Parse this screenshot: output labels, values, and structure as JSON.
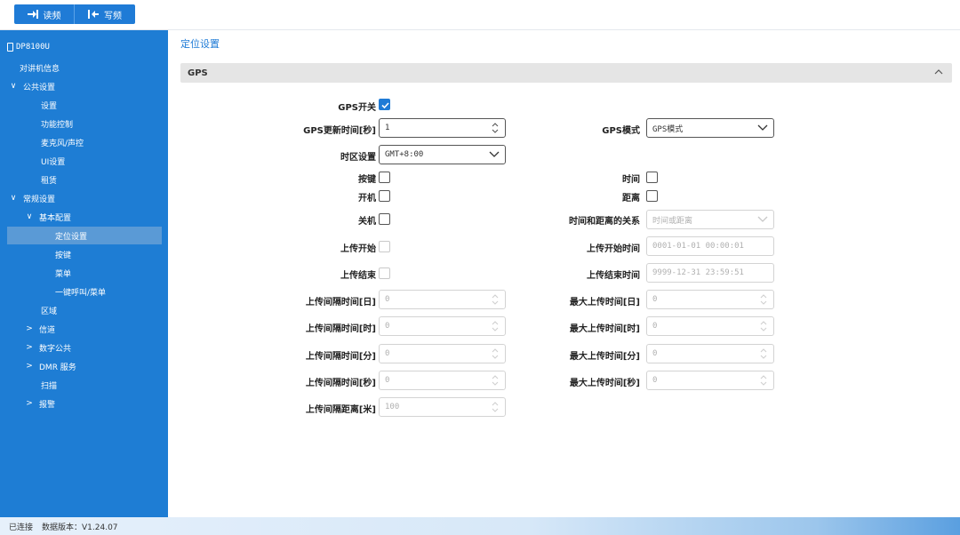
{
  "toolbar": {
    "read_label": "读频",
    "write_label": "写频"
  },
  "sidebar": {
    "device": "DP8100U",
    "items": [
      {
        "label": "对讲机信息",
        "chevron": ""
      },
      {
        "label": "公共设置",
        "chevron": "∨"
      },
      {
        "label": "设置",
        "chevron": ""
      },
      {
        "label": "功能控制",
        "chevron": ""
      },
      {
        "label": "麦克风/声控",
        "chevron": ""
      },
      {
        "label": "UI设置",
        "chevron": ""
      },
      {
        "label": "租赁",
        "chevron": ""
      },
      {
        "label": "常规设置",
        "chevron": "∨"
      },
      {
        "label": "基本配置",
        "chevron": "∨"
      },
      {
        "label": "定位设置",
        "chevron": "",
        "selected": true
      },
      {
        "label": "按键",
        "chevron": ""
      },
      {
        "label": "菜单",
        "chevron": ""
      },
      {
        "label": "一键呼叫/菜单",
        "chevron": ""
      },
      {
        "label": "区域",
        "chevron": ""
      },
      {
        "label": "信道",
        "chevron": ">"
      },
      {
        "label": "数字公共",
        "chevron": ">"
      },
      {
        "label": "DMR 服务",
        "chevron": ">"
      },
      {
        "label": "扫描",
        "chevron": ""
      },
      {
        "label": "报警",
        "chevron": ">"
      }
    ]
  },
  "main": {
    "page_title": "定位设置",
    "section_title": "GPS",
    "gps_switch": {
      "label": "GPS开关",
      "checked": true
    },
    "gps_update": {
      "label": "GPS更新时间[秒]",
      "value": "1"
    },
    "gps_mode": {
      "label": "GPS模式",
      "value": "GPS模式"
    },
    "timezone": {
      "label": "时区设置",
      "value": "GMT+8:00"
    },
    "key": {
      "label": "按键"
    },
    "time": {
      "label": "时间"
    },
    "power_on": {
      "label": "开机"
    },
    "distance": {
      "label": "距离"
    },
    "power_off": {
      "label": "关机"
    },
    "time_distance_relation": {
      "label": "时间和距离的关系",
      "value": "时间或距离"
    },
    "upload_start": {
      "label": "上传开始"
    },
    "upload_start_time": {
      "label": "上传开始时间",
      "value": "0001-01-01 00:00:01"
    },
    "upload_end": {
      "label": "上传结束"
    },
    "upload_end_time": {
      "label": "上传结束时间",
      "value": "9999-12-31 23:59:51"
    },
    "interval_day": {
      "label": "上传间隔时间[日]",
      "value": "0"
    },
    "max_day": {
      "label": "最大上传时间[日]",
      "value": "0"
    },
    "interval_hour": {
      "label": "上传间隔时间[时]",
      "value": "0"
    },
    "max_hour": {
      "label": "最大上传时间[时]",
      "value": "0"
    },
    "interval_min": {
      "label": "上传间隔时间[分]",
      "value": "0"
    },
    "max_min": {
      "label": "最大上传时间[分]",
      "value": "0"
    },
    "interval_sec": {
      "label": "上传间隔时间[秒]",
      "value": "0"
    },
    "max_sec": {
      "label": "最大上传时间[秒]",
      "value": "0"
    },
    "interval_distance": {
      "label": "上传间隔距离[米]",
      "value": "100"
    }
  },
  "status": {
    "connection": "已连接",
    "data_version": "数据版本：V1.24.07"
  },
  "colors": {
    "accent": "#1f7bd6",
    "sidebar": "#1e7dd4",
    "selected": "#5a9ad6"
  },
  "icons": {
    "read": "download-icon",
    "write": "upload-icon",
    "collapse": "chevron-up-icon"
  }
}
